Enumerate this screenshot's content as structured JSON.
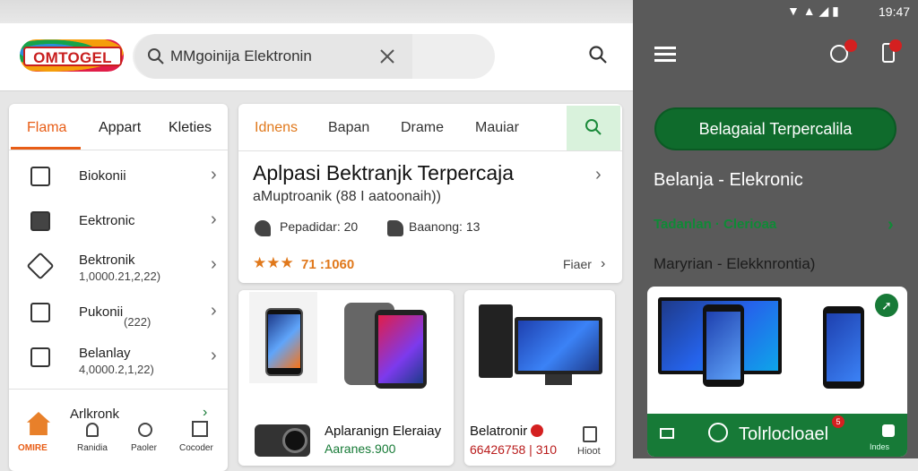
{
  "header": {
    "logo_text": "OMTOGEL",
    "search_value": "MMgoinija Elektronin",
    "clear_icon": "close-icon",
    "search_icon": "search-icon"
  },
  "left": {
    "tabs": [
      "Flama",
      "Appart",
      "Kleties"
    ],
    "items": [
      {
        "label": "Biokonii",
        "sub": ""
      },
      {
        "label": "Eektronic",
        "sub": ""
      },
      {
        "label": "Bektronik",
        "sub": "1,0000.21,2,22)"
      },
      {
        "label": "Pukonii",
        "sub": "(222)"
      },
      {
        "label": "Belanlay",
        "sub": "4,0000.2,1,22)"
      },
      {
        "label": "Arlkronk",
        "sub": ""
      }
    ],
    "nav": [
      "OMIRE",
      "Ranidia",
      "Paoler",
      "Cocoder"
    ]
  },
  "mid": {
    "tabs": [
      "Idnens",
      "Bapan",
      "Drame",
      "Mauiar"
    ],
    "title": "Aplpasi Bektranjk Terpercaja",
    "subtitle": "aMuptroanik (88 I aatoonaih))",
    "stat1": "Pepadidar: 20",
    "stat2": "Baanong: 13",
    "rating": "71 :1060",
    "filter": "Fiaer"
  },
  "cards": [
    {
      "name": "Aplaranign Eleraiay",
      "price": "Aaranes.900"
    },
    {
      "name": "Belatronir",
      "price": "66426758 | 310",
      "extra": "Hioot"
    }
  ],
  "right": {
    "status_time": "19:47",
    "button": "Belagaial Terpercalila",
    "heading": "Belanja - Elekronic",
    "link": "Tadanlan · Clerioaa",
    "sub": "Maryrian - Elekknrontia)",
    "bar_text": "Tolrlocloael",
    "bar_badge": "5",
    "bar_right": "Indes"
  },
  "colors": {
    "accent": "#e85d16",
    "green": "#177a37",
    "rating": "#e0781b"
  }
}
